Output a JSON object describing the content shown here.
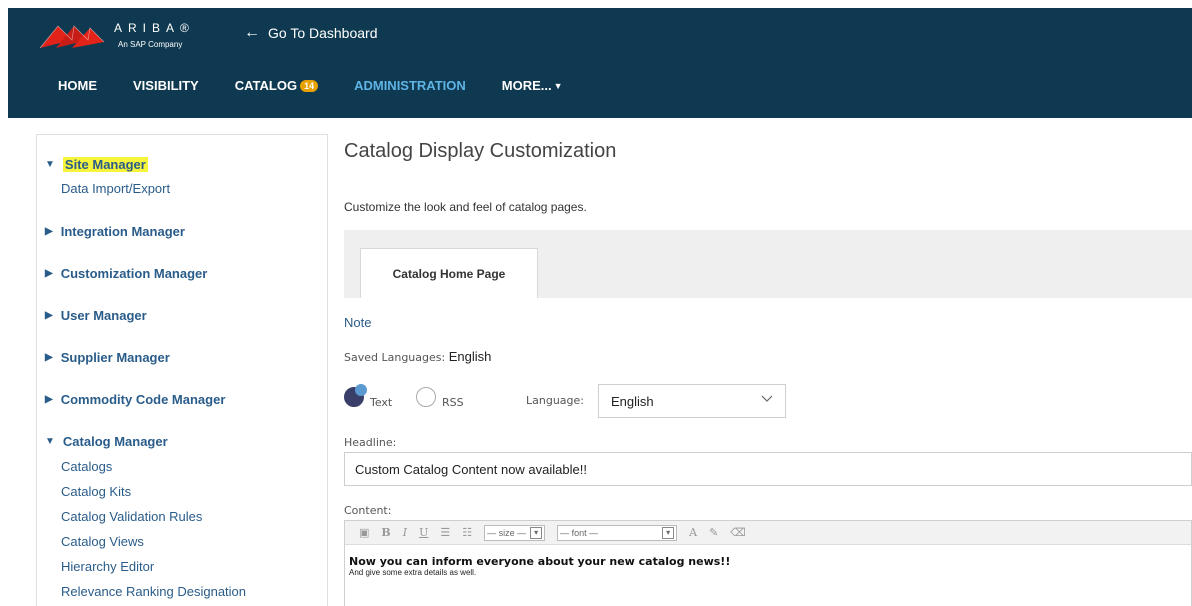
{
  "header": {
    "logo_text": "ARIBA®",
    "logo_sub": "An SAP Company",
    "dashboard_link": "Go To Dashboard",
    "nav": [
      {
        "label": "HOME"
      },
      {
        "label": "VISIBILITY"
      },
      {
        "label": "CATALOG",
        "badge": "14"
      },
      {
        "label": "ADMINISTRATION"
      },
      {
        "label": "MORE..."
      }
    ]
  },
  "sidebar": {
    "site_manager": "Site Manager",
    "data_import_export": "Data Import/Export",
    "integration_manager": "Integration Manager",
    "customization_manager": "Customization Manager",
    "user_manager": "User Manager",
    "supplier_manager": "Supplier Manager",
    "commodity_code_manager": "Commodity Code Manager",
    "catalog_manager": "Catalog Manager",
    "catalog_items": [
      "Catalogs",
      "Catalog Kits",
      "Catalog Validation Rules",
      "Catalog Views",
      "Hierarchy Editor",
      "Relevance Ranking Designation"
    ]
  },
  "main": {
    "title": "Catalog Display Customization",
    "description": "Customize the look and feel of catalog pages.",
    "tab": "Catalog Home Page",
    "note": "Note",
    "saved_languages_label": "Saved Languages:",
    "saved_languages_value": "English",
    "radio_text": "Text",
    "radio_rss": "RSS",
    "language_label": "Language:",
    "language_value": "English",
    "headline_label": "Headline:",
    "headline_value": "Custom Catalog Content now available!!",
    "content_label": "Content:",
    "toolbar": {
      "bold": "B",
      "italic": "I",
      "underline": "U",
      "size": "— size —",
      "font": "— font —"
    },
    "content_line1": "Now you can inform everyone about your new catalog news!!",
    "content_line2": "And give some extra details as well."
  },
  "colors": {
    "header_bg": "#0f3950",
    "active_nav": "#5fb4e6",
    "link": "#2a5c8a",
    "highlight": "#f7f43c",
    "badge": "#e8a200"
  }
}
